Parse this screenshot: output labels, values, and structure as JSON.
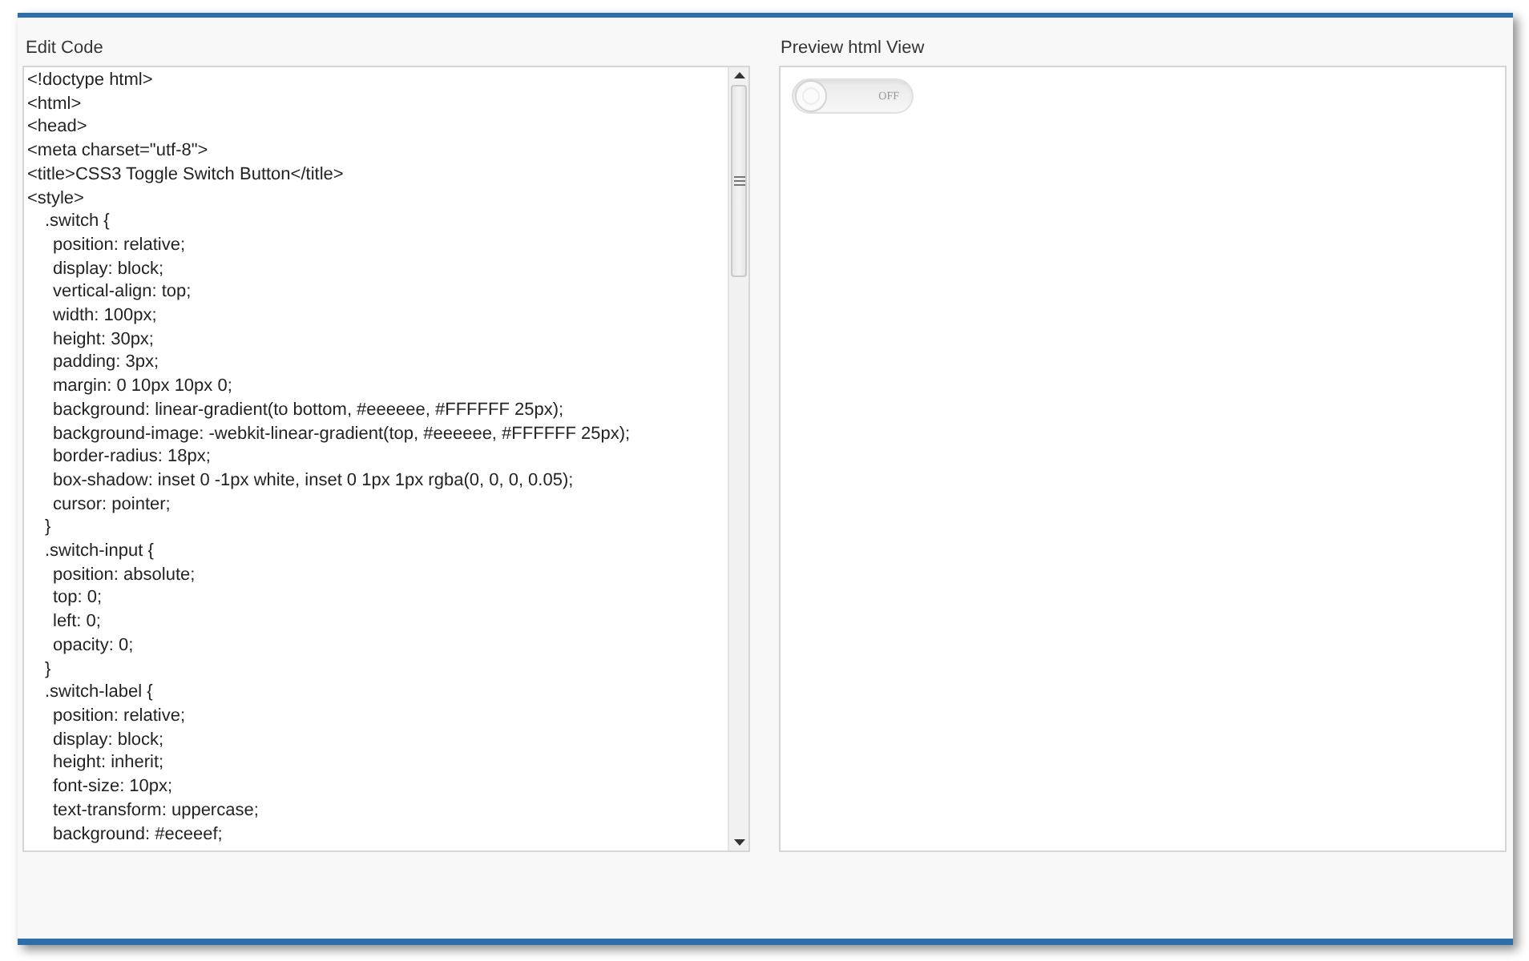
{
  "editor": {
    "label": "Edit Code",
    "lines": [
      {
        "text": "<!doctype html>"
      },
      {
        "text": "<html>"
      },
      {
        "text": "<head>"
      },
      {
        "text": "<meta charset=\"utf-8\">"
      },
      {
        "text": "<title>CSS3 Toggle Switch Button</title>"
      },
      {
        "text": "<style>",
        "children": [
          {
            "text": ".switch {",
            "children": [
              {
                "text": "position: relative;"
              },
              {
                "text": "display: block;"
              },
              {
                "text": "vertical-align: top;"
              },
              {
                "text": "width: 100px;"
              },
              {
                "text": "height: 30px;"
              },
              {
                "text": "padding: 3px;"
              },
              {
                "text": "margin: 0 10px 10px 0;"
              },
              {
                "text": "background: linear-gradient(to bottom, #eeeeee, #FFFFFF 25px);"
              },
              {
                "text": "background-image: -webkit-linear-gradient(top, #eeeeee, #FFFFFF 25px);"
              },
              {
                "text": "border-radius: 18px;"
              },
              {
                "text": "box-shadow: inset 0 -1px white, inset 0 1px 1px rgba(0, 0, 0, 0.05);"
              },
              {
                "text": "cursor: pointer;"
              }
            ]
          },
          {
            "text": "}"
          },
          {
            "text": ".switch-input {",
            "children": [
              {
                "text": "position: absolute;"
              },
              {
                "text": "top: 0;"
              },
              {
                "text": "left: 0;"
              },
              {
                "text": "opacity: 0;"
              }
            ]
          },
          {
            "text": "}"
          },
          {
            "text": ".switch-label {",
            "children": [
              {
                "text": "position: relative;"
              },
              {
                "text": "display: block;"
              },
              {
                "text": "height: inherit;"
              },
              {
                "text": "font-size: 10px;"
              },
              {
                "text": "text-transform: uppercase;"
              },
              {
                "text": "background: #eceeef;"
              }
            ]
          }
        ]
      }
    ]
  },
  "preview": {
    "label": "Preview html View",
    "switch": {
      "label": "OFF",
      "on": false
    }
  }
}
